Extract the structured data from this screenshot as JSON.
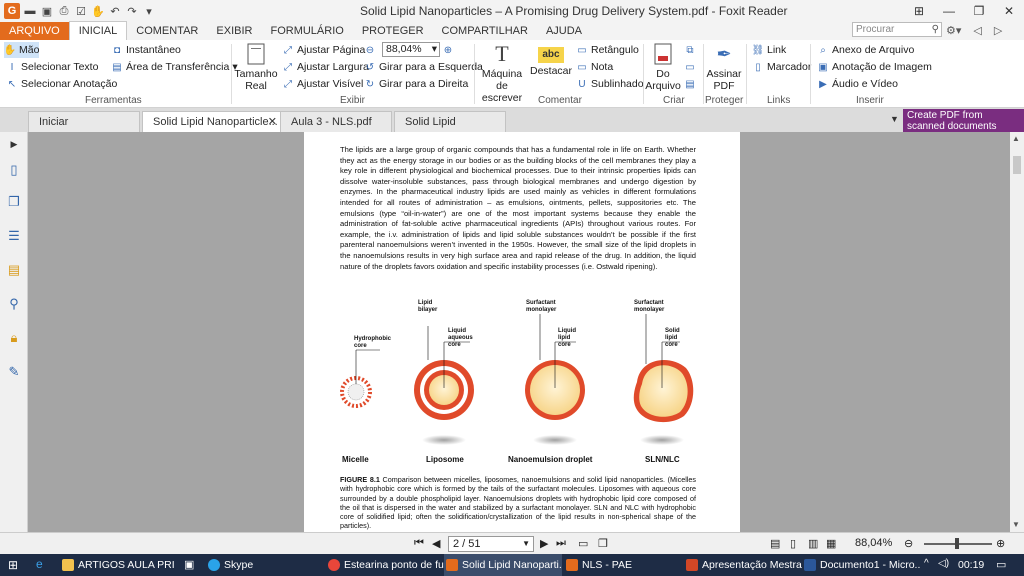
{
  "window": {
    "title": "Solid Lipid Nanoparticles – A Promising Drug Delivery System.pdf - Foxit Reader",
    "app_logo": "G"
  },
  "ribbon_tabs": [
    "ARQUIVO",
    "INICIAL",
    "COMENTAR",
    "EXIBIR",
    "FORMULÁRIO",
    "PROTEGER",
    "COMPARTILHAR",
    "AJUDA"
  ],
  "search": {
    "placeholder": "Procurar"
  },
  "ribbon": {
    "ferramentas": {
      "label": "Ferramentas",
      "mao": "Mão",
      "selecionar_texto": "Selecionar Texto",
      "selecionar_anotacao": "Selecionar Anotação",
      "instantaneo": "Instantâneo",
      "area_transferencia": "Área de Transferência"
    },
    "exibir": {
      "label": "Exibir",
      "tamanho_real_1": "Tamanho",
      "tamanho_real_2": "Real",
      "ajustar_pagina": "Ajustar Página",
      "ajustar_largura": "Ajustar Largura",
      "ajustar_visivel": "Ajustar Visível",
      "zoom_value": "88,04%",
      "girar_esquerda": "Girar para a Esquerda",
      "girar_direita": "Girar para a Direita"
    },
    "comentar": {
      "label": "Comentar",
      "maquina_1": "Máquina de",
      "maquina_2": "escrever",
      "destacar": "Destacar",
      "retangulo": "Retângulo",
      "nota": "Nota",
      "sublinhado": "Sublinhado"
    },
    "criar": {
      "label": "Criar",
      "do_arquivo_1": "Do",
      "do_arquivo_2": "Arquivo"
    },
    "proteger": {
      "label": "Proteger",
      "assinar_1": "Assinar",
      "assinar_2": "PDF"
    },
    "links": {
      "label": "Links",
      "link": "Link",
      "marcador": "Marcador"
    },
    "inserir": {
      "label": "Inserir",
      "anexo": "Anexo de Arquivo",
      "anotacao_imagem": "Anotação de Imagem",
      "audio_video": "Áudio e Vídeo"
    }
  },
  "doc_tabs": [
    {
      "label": "Iniciar",
      "active": false
    },
    {
      "label": "Solid Lipid Nanoparticle...",
      "active": true
    },
    {
      "label": "Aula 3 - NLS.pdf",
      "active": false
    },
    {
      "label": "Solid Lipid Nanoparticl...",
      "active": false
    }
  ],
  "create_pdf_banner": {
    "line1": "Create PDF from",
    "line2": "scanned documents"
  },
  "document": {
    "paragraph": "The lipids are a large group of organic compounds that has a fundamental role in life on Earth. Whether they act as the energy storage in our bodies or as the building blocks of the cell membranes they play a key role in different physiological and biochemical processes. Due to their intrinsic properties lipids can dissolve water-insoluble substances, pass through biological membranes and undergo digestion by enzymes. In the pharmaceutical industry lipids are used mainly as vehicles in different formulations intended for all routes of administration – as emulsions, ointments, pellets, suppositories etc. The emulsions (type “oil-in-water”) are one of the most important systems because they enable the administration of fat-soluble active pharmaceutical ingredients (APIs) throughout various routes. For example, the i.v. administration of lipids and lipid soluble substances wouldn’t be possible if the first parenteral nanoemulsions weren’t invented in the 1950s. However, the small size of the lipid droplets in the nanoemulsions results in very high surface area and rapid release of the drug. In addition, the liquid nature of the droplets favors oxidation and specific instability processes (i.e. Ostwald ripening).",
    "figure": {
      "labels": {
        "hydrophobic_core": "Hydrophobic\ncore",
        "lipid_bilayer": "Lipid\nbilayer",
        "liquid_aqueous_core": "Liquid\naqueous\ncore",
        "surfactant_monolayer_1": "Surfactant\nmonolayer",
        "liquid_lipid_core": "Liquid\nlipid\ncore",
        "surfactant_monolayer_2": "Surfactant\nmonolayer",
        "solid_lipid_core": "Solid\nlipid\ncore"
      },
      "captions": [
        "Micelle",
        "Liposome",
        "Nanoemulsion droplet",
        "SLN/NLC"
      ]
    },
    "caption_title": "FIGURE 8.1",
    "caption_text": "Comparison between micelles, liposomes, nanoemulsions and solid lipid nanoparticles. (Micelles with hydrophobic core which is formed by the tails of the surfactant molecules. Liposomes with aqueous core surrounded by a double phospholipid layer. Nanoemulsions droplets with hydrophobic lipid core composed of the oil that is dispersed in the water and stabilized by a surfactant monolayer. SLN and NLC with hydrophobic core of solidified lipid; often the solidification/crystallization of the lipid results in non-spherical shape of the particles)."
  },
  "statusbar": {
    "page_indicator": "2 / 51",
    "zoom": "88,04%"
  },
  "taskbar": {
    "items": [
      {
        "label": "ARTIGOS AULA PRI",
        "color": "#f2c14e",
        "active": false
      },
      {
        "label": "Skype",
        "color": "#2aa3e8",
        "active": false
      },
      {
        "label": "Estearina ponto de fu...",
        "color": "#e9463a",
        "active": false
      },
      {
        "label": "Solid Lipid Nanoparti...",
        "color": "#e36b1d",
        "active": true
      },
      {
        "label": "NLS - PAE",
        "color": "#e36b1d",
        "active": false
      },
      {
        "label": "Apresentação Mestra...",
        "color": "#d24726",
        "active": false
      },
      {
        "label": "Documento1 - Micro...",
        "color": "#2b579a",
        "active": false
      }
    ],
    "clock": "00:19"
  },
  "colors": {
    "accent_orange": "#e36b1d",
    "banner_purple": "#7a2d80",
    "taskbar_bg": "#1e2c45",
    "viewer_bg": "#a5a5a5"
  }
}
